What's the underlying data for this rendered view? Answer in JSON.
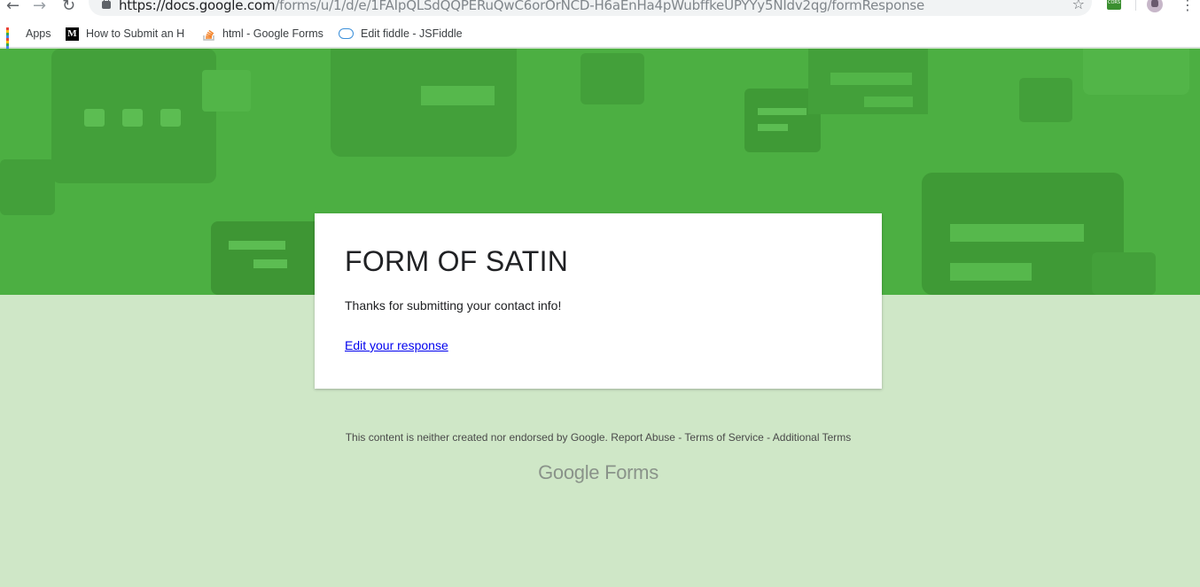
{
  "browser": {
    "url_host": "https://docs.google.com",
    "url_path": "/forms/u/1/d/e/1FAIpQLSdQQPERuQwC6orOrNCD-H6aEnHa4pWubffkeUPYYy5NIdv2qg/formResponse",
    "extension_label": "CORS"
  },
  "bookmarks": [
    {
      "label": "Apps",
      "icon": "apps-grid-icon"
    },
    {
      "label": "How to Submit an H",
      "icon": "medium-icon"
    },
    {
      "label": "html - Google Forms",
      "icon": "stackoverflow-icon"
    },
    {
      "label": "Edit fiddle - JSFiddle",
      "icon": "jsfiddle-cloud-icon"
    }
  ],
  "form": {
    "title": "FORM OF SATIN",
    "confirmation": "Thanks for submitting your contact info!",
    "edit_link": "Edit your response"
  },
  "footer": {
    "disclaimer": "This content is neither created nor endorsed by Google.",
    "report_abuse": "Report Abuse",
    "terms": "Terms of Service",
    "additional_terms": "Additional Terms",
    "logo_google": "Google",
    "logo_forms": "Forms"
  },
  "colors": {
    "banner": "#4caf42",
    "background": "#cfe7c7",
    "link": "#0000ee"
  }
}
